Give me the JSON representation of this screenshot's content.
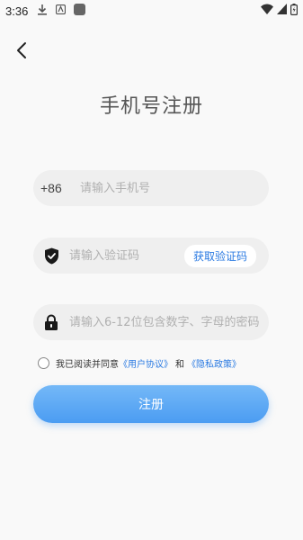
{
  "status_bar": {
    "time": "3:36",
    "left_icons": [
      "download-icon",
      "notification-icon",
      "app-icon"
    ],
    "right_icons": [
      "wifi-icon",
      "signal-icon",
      "battery-icon"
    ]
  },
  "header": {
    "title": "手机号注册",
    "back_icon": "chevron-left-icon"
  },
  "form": {
    "phone": {
      "country_code": "+86",
      "placeholder": "请输入手机号",
      "value": ""
    },
    "code": {
      "icon": "shield-check-icon",
      "placeholder": "请输入验证码",
      "value": "",
      "get_code_label": "获取验证码"
    },
    "password": {
      "icon": "lock-icon",
      "placeholder": "请输入6-12位包含数字、字母的密码",
      "value": ""
    },
    "agreement": {
      "checked": false,
      "prefix": "我已阅读并同意",
      "user_agreement": "《用户协议》",
      "and": "和",
      "privacy_policy": "《隐私政策》"
    },
    "submit_label": "注册"
  },
  "colors": {
    "accent": "#2a7ae2",
    "button_top": "#74b8f7",
    "button_bottom": "#4b9cf2",
    "field_bg": "#efefef",
    "page_bg": "#f9f9f9"
  }
}
